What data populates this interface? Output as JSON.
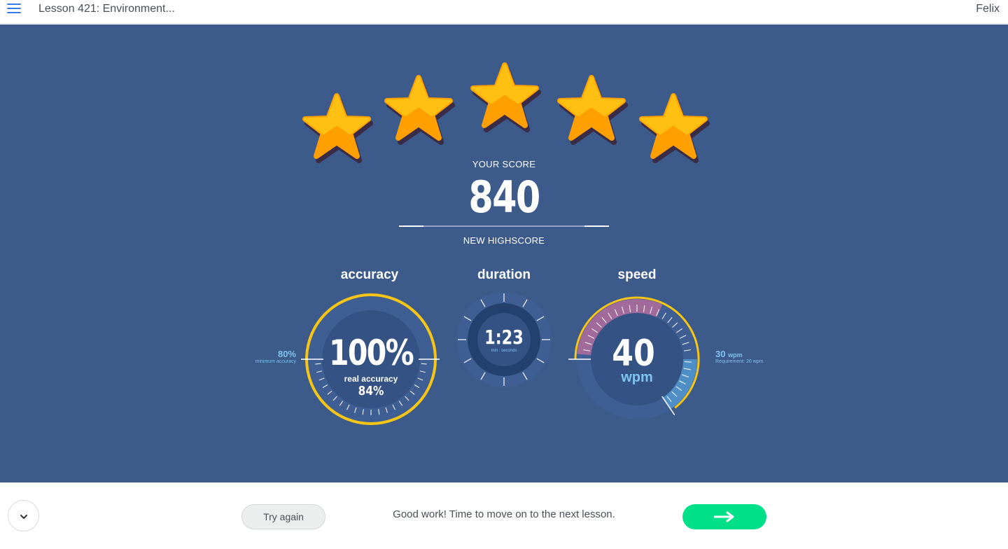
{
  "header": {
    "lesson_title": "Lesson 421: Environment...",
    "user_name": "Felix"
  },
  "result": {
    "stars_earned": 5,
    "stars_total": 5,
    "score_label": "YOUR SCORE",
    "score": "840",
    "highscore_label": "NEW HIGHSCORE"
  },
  "accuracy": {
    "title": "accuracy",
    "value": "100%",
    "real_label": "real accuracy",
    "real_value": "84%",
    "min_value": "80%",
    "min_label": "minimum accuracy"
  },
  "duration": {
    "title": "duration",
    "value": "1:23",
    "unit": "min : seconds"
  },
  "speed": {
    "title": "speed",
    "value": "40",
    "unit": "wpm",
    "target_value": "30",
    "target_unit": "wpm",
    "requirement": "Requirement: 20 wpm"
  },
  "footer": {
    "try_again_label": "Try again",
    "message": "Good work! Time to move on to the next lesson."
  },
  "colors": {
    "panel": "#3c5a8a",
    "star": "#ffaa00",
    "gauge_ring": "#f7c515",
    "next_button": "#00e089",
    "accent_light_blue": "#7fc4ef",
    "speed_slow_zone": "#a06a9a"
  },
  "icons": {
    "menu": "hamburger-icon",
    "collapse": "chevron-down-icon",
    "next": "arrow-right-icon"
  }
}
